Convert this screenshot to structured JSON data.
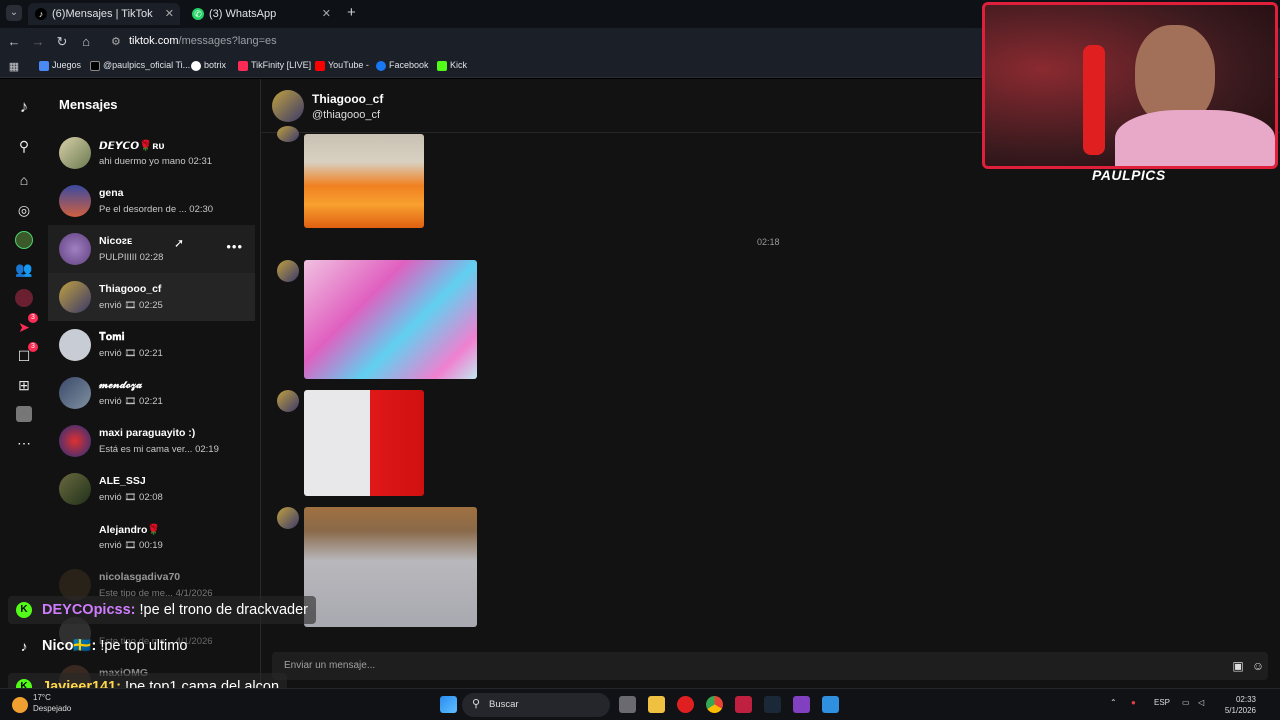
{
  "browser": {
    "tabs": [
      {
        "label": "(6)Mensajes | TikTok",
        "icon": "tiktok-icon"
      },
      {
        "label": "(3) WhatsApp",
        "icon": "whatsapp-icon"
      }
    ],
    "url_host": "tiktok.com",
    "url_path": "/messages?lang=es",
    "bookmarks": [
      {
        "label": "Juegos",
        "color": "#4a8af4"
      },
      {
        "label": "@paulpics_oficial Ti...",
        "color": "#111111"
      },
      {
        "label": "botrix",
        "color": "#ffffff"
      },
      {
        "label": "TikFinity [LIVE]",
        "color": "#fe2c55"
      },
      {
        "label": "YouTube -",
        "color": "#ff0000"
      },
      {
        "label": "Facebook",
        "color": "#1877f2"
      },
      {
        "label": "Kick",
        "color": "#53fc18"
      }
    ]
  },
  "sidebar": {
    "title": "Mensajes",
    "badges": {
      "activity": "3",
      "messages": "3"
    },
    "conversations": [
      {
        "name": "𝘿𝙀𝙔𝘾𝙊🌹ʀᴜ",
        "last": "ahi duermo yo mano 02:31"
      },
      {
        "name": "gena",
        "last": "Pe el desorden de ... 02:30"
      },
      {
        "name": "Nicoᴤᴇ",
        "last": "PULPIIIII 02:28"
      },
      {
        "name": "Thiagooo_cf",
        "last": "envió 🎞 02:25"
      },
      {
        "name": "𝐓𝐨𝐦𝐢",
        "last": "envió 🎞 02:21"
      },
      {
        "name": "𝓶𝓮𝓷𝓭𝓸𝔃𝓪",
        "last": "envió 🎞 02:21"
      },
      {
        "name": "maxi paraguayito :)",
        "last": "Está es mi cama ver... 02:19"
      },
      {
        "name": "ALE_SSJ",
        "last": "envió 🎞 02:08"
      },
      {
        "name": "Alejandro🌹",
        "last": "envió 🎞 00:19"
      },
      {
        "name": "nicolasgadiva70",
        "last": "Este tipo de me... 4/1/2026"
      },
      {
        "name": "",
        "last": "Este tipo de me... 4/1/2026"
      },
      {
        "name": "maxiOMG",
        "last": ""
      }
    ]
  },
  "chat": {
    "name": "Thiagooo_cf",
    "handle": "@thiagooo_cf",
    "timestamp": "02:18",
    "compose_placeholder": "Enviar un mensaje..."
  },
  "overlay": [
    {
      "user": "DEYCOpicss:",
      "text": " !pe el trono de drackvader",
      "user_color": "#d07cff",
      "icon": "kick-icon"
    },
    {
      "user": "Nico🇸🇪:",
      "text": " !pe top ultimo",
      "user_color": "#ffffff",
      "icon": "tiktok-icon"
    },
    {
      "user": "Javieer141:",
      "text": " !pe top1 cama del alcon",
      "user_color": "#ffd84a",
      "icon": "kick-icon"
    }
  ],
  "webcam": {
    "logo": "PAULPICS"
  },
  "taskbar": {
    "weather_temp": "17°C",
    "weather_text": "Despejado",
    "search_label": "Buscar",
    "lang": "ESP",
    "time": "02:33",
    "date": "5/1/2026"
  }
}
